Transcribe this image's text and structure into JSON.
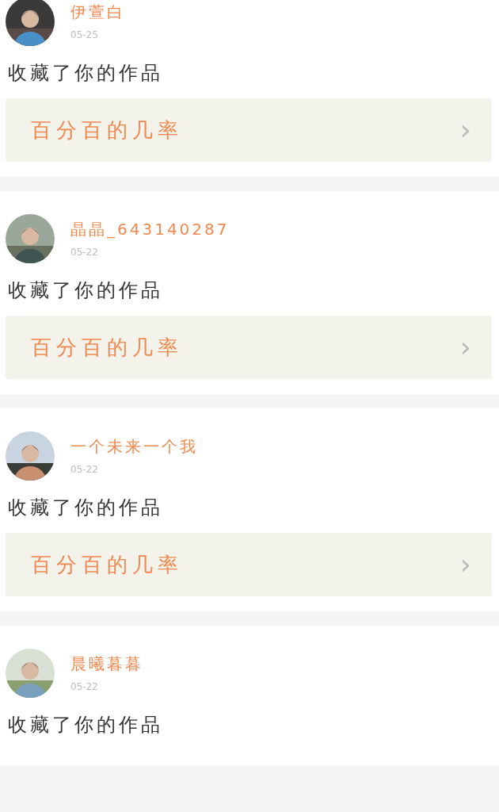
{
  "notifications": [
    {
      "user": "伊萱白",
      "date": "05-25",
      "action": "收藏了你的作品",
      "work": {
        "title": "百分百的几率",
        "chevron": "›"
      }
    },
    {
      "user": "晶晶_643140287",
      "date": "05-22",
      "action": "收藏了你的作品",
      "work": {
        "title": "百分百的几率",
        "chevron": "›"
      }
    },
    {
      "user": "一个未来一个我",
      "date": "05-22",
      "action": "收藏了你的作品",
      "work": {
        "title": "百分百的几率",
        "chevron": "›"
      }
    },
    {
      "user": "晨曦暮暮",
      "date": "05-22",
      "action": "收藏了你的作品"
    }
  ]
}
